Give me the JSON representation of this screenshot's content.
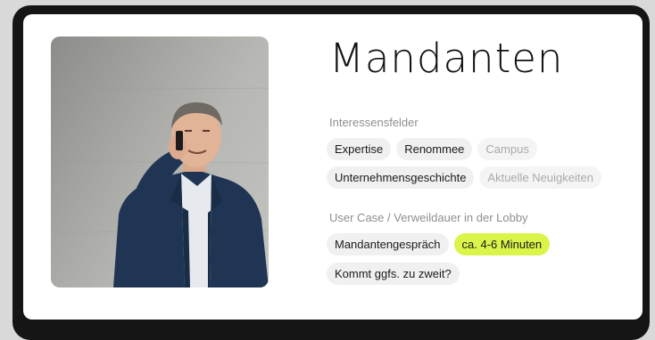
{
  "card": {
    "title": "Mandanten",
    "interests_label": "Interessensfelder",
    "interests_row1": [
      {
        "label": "Expertise",
        "state": "active"
      },
      {
        "label": "Renommee",
        "state": "active"
      },
      {
        "label": "Campus",
        "state": "muted"
      }
    ],
    "interests_row2": [
      {
        "label": "Unternehmensgeschichte",
        "state": "active"
      },
      {
        "label": "Aktuelle Neuigkeiten",
        "state": "muted"
      }
    ],
    "usecase_label": "User Case / Verweildauer in der Lobby",
    "usecase_row1": [
      {
        "label": "Mandantengespräch",
        "state": "active"
      },
      {
        "label": "ca. 4-6 Minuten",
        "state": "highlight"
      }
    ],
    "usecase_row2": [
      {
        "label": "Kommt ggfs. zu zweit?",
        "state": "active"
      }
    ]
  },
  "colors": {
    "highlight": "#dcf34a",
    "chip_bg": "#f0f0f0",
    "muted_text": "#a9a9a9",
    "frame": "#151515"
  },
  "icons": {
    "photo": "man-on-phone-portrait"
  }
}
